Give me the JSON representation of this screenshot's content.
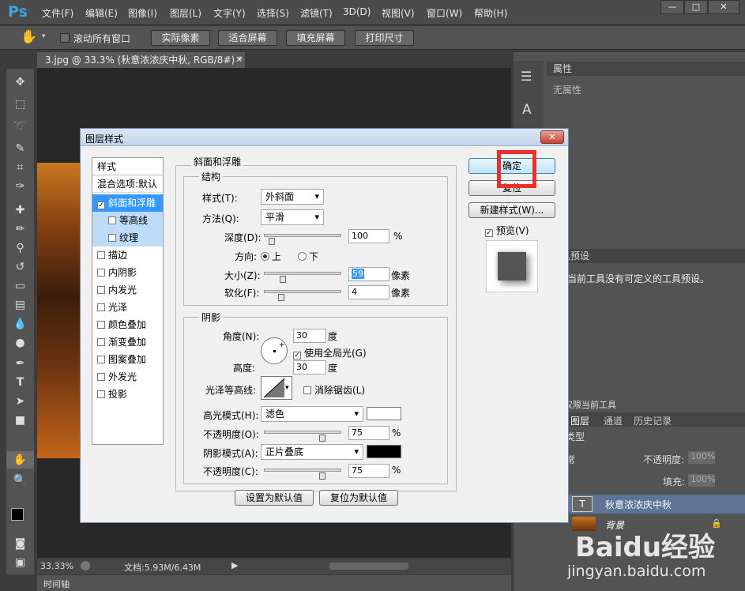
{
  "app": {
    "logo": "Ps"
  },
  "menu": [
    "文件(F)",
    "编辑(E)",
    "图像(I)",
    "图层(L)",
    "文字(Y)",
    "选择(S)",
    "滤镜(T)",
    "3D(D)",
    "视图(V)",
    "窗口(W)",
    "帮助(H)"
  ],
  "window_controls": {
    "minimize": "—",
    "maximize": "□",
    "close": "✕"
  },
  "options_bar": {
    "scroll_all_label": "滚动所有窗口",
    "btn_actual": "实际像素",
    "btn_fit": "适合屏幕",
    "btn_fill": "填充屏幕",
    "btn_print": "打印尺寸"
  },
  "document": {
    "tab_title": "3.jpg @ 33.3% (秋意浓浓庆中秋, RGB/8#) *",
    "zoom": "33.33%",
    "doc_info": "文档:5.93M/6.43M",
    "timeline": "时间轴"
  },
  "dialog": {
    "title": "图层样式",
    "close": "✕",
    "style_list": {
      "header": "样式",
      "blend": "混合选项:默认",
      "items": [
        {
          "label": "斜面和浮雕",
          "checked": true,
          "selected": true
        },
        {
          "label": "等高线",
          "checked": false,
          "sub": true
        },
        {
          "label": "纹理",
          "checked": false,
          "sub": true
        },
        {
          "label": "描边",
          "checked": false
        },
        {
          "label": "内阴影",
          "checked": false
        },
        {
          "label": "内发光",
          "checked": false
        },
        {
          "label": "光泽",
          "checked": false
        },
        {
          "label": "颜色叠加",
          "checked": false
        },
        {
          "label": "渐变叠加",
          "checked": false
        },
        {
          "label": "图案叠加",
          "checked": false
        },
        {
          "label": "外发光",
          "checked": false
        },
        {
          "label": "投影",
          "checked": false
        }
      ]
    },
    "bevel": {
      "section_title": "斜面和浮雕",
      "structure_title": "结构",
      "style_label": "样式(T):",
      "style_value": "外斜面",
      "method_label": "方法(Q):",
      "method_value": "平滑",
      "depth_label": "深度(D):",
      "depth_value": "100",
      "depth_unit": "%",
      "depth_level": 0.1,
      "direction_label": "方向:",
      "dir_up": "上",
      "dir_down": "下",
      "size_label": "大小(Z):",
      "size_value": "59",
      "size_unit": "像素",
      "size_level": 0.24,
      "soften_label": "软化(F):",
      "soften_value": "4",
      "soften_unit": "像素",
      "soften_level": 0.22
    },
    "shading": {
      "title": "阴影",
      "angle_label": "角度(N):",
      "angle_value": "30",
      "angle_unit": "度",
      "global_light_label": "使用全局光(G)",
      "altitude_label": "高度:",
      "altitude_value": "30",
      "altitude_unit": "度",
      "gloss_label": "光泽等高线:",
      "antialias_label": "消除锯齿(L)",
      "highlight_label": "高光模式(H):",
      "highlight_mode": "滤色",
      "highlight_color": "#ffffff",
      "highlight_opacity_label": "不透明度(O):",
      "highlight_opacity": "75",
      "highlight_opacity_level": 0.75,
      "shadow_label": "阴影模式(A):",
      "shadow_mode": "正片叠底",
      "shadow_color": "#000000",
      "shadow_opacity_label": "不透明度(C):",
      "shadow_opacity": "75",
      "shadow_opacity_level": 0.75,
      "pct": "%"
    },
    "btn_default": "设置为默认值",
    "btn_reset": "复位为默认值",
    "btn_ok": "确定",
    "btn_cancel": "复位",
    "btn_new_style": "新建样式(W)...",
    "preview_label": "预览(V)"
  },
  "panels": {
    "properties_title": "属性",
    "properties_empty": "无属性",
    "presets_title": "具预设",
    "presets_text": "当前工具没有可定义的工具预设。",
    "current_tool_only": "仅限当前工具",
    "tabs": [
      "图层",
      "通道",
      "历史记录"
    ],
    "kind_label": "类型",
    "blend_mode": "常",
    "opacity_label": "不透明度:",
    "opacity_value": "100%",
    "fill_label": "填充:",
    "fill_value": "100%",
    "layers": [
      "秋意浓浓庆中秋",
      "背景"
    ]
  },
  "watermark": {
    "brand": "Baidu经验",
    "url": "jingyan.baidu.com"
  }
}
